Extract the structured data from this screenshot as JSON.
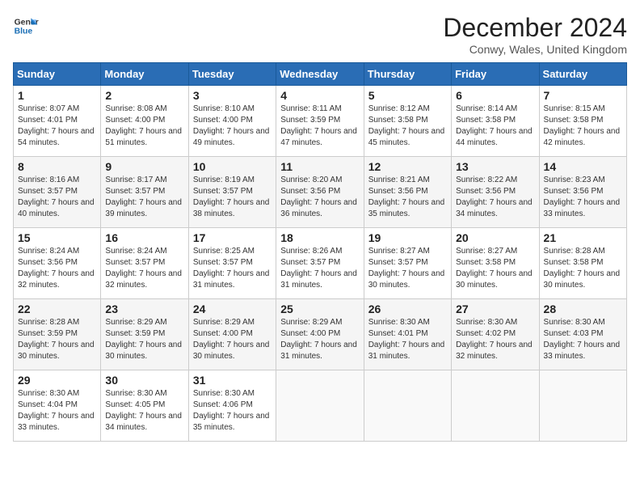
{
  "header": {
    "logo_line1": "General",
    "logo_line2": "Blue",
    "month": "December 2024",
    "location": "Conwy, Wales, United Kingdom"
  },
  "days_of_week": [
    "Sunday",
    "Monday",
    "Tuesday",
    "Wednesday",
    "Thursday",
    "Friday",
    "Saturday"
  ],
  "weeks": [
    [
      {
        "day": "1",
        "sunrise": "Sunrise: 8:07 AM",
        "sunset": "Sunset: 4:01 PM",
        "daylight": "Daylight: 7 hours and 54 minutes."
      },
      {
        "day": "2",
        "sunrise": "Sunrise: 8:08 AM",
        "sunset": "Sunset: 4:00 PM",
        "daylight": "Daylight: 7 hours and 51 minutes."
      },
      {
        "day": "3",
        "sunrise": "Sunrise: 8:10 AM",
        "sunset": "Sunset: 4:00 PM",
        "daylight": "Daylight: 7 hours and 49 minutes."
      },
      {
        "day": "4",
        "sunrise": "Sunrise: 8:11 AM",
        "sunset": "Sunset: 3:59 PM",
        "daylight": "Daylight: 7 hours and 47 minutes."
      },
      {
        "day": "5",
        "sunrise": "Sunrise: 8:12 AM",
        "sunset": "Sunset: 3:58 PM",
        "daylight": "Daylight: 7 hours and 45 minutes."
      },
      {
        "day": "6",
        "sunrise": "Sunrise: 8:14 AM",
        "sunset": "Sunset: 3:58 PM",
        "daylight": "Daylight: 7 hours and 44 minutes."
      },
      {
        "day": "7",
        "sunrise": "Sunrise: 8:15 AM",
        "sunset": "Sunset: 3:58 PM",
        "daylight": "Daylight: 7 hours and 42 minutes."
      }
    ],
    [
      {
        "day": "8",
        "sunrise": "Sunrise: 8:16 AM",
        "sunset": "Sunset: 3:57 PM",
        "daylight": "Daylight: 7 hours and 40 minutes."
      },
      {
        "day": "9",
        "sunrise": "Sunrise: 8:17 AM",
        "sunset": "Sunset: 3:57 PM",
        "daylight": "Daylight: 7 hours and 39 minutes."
      },
      {
        "day": "10",
        "sunrise": "Sunrise: 8:19 AM",
        "sunset": "Sunset: 3:57 PM",
        "daylight": "Daylight: 7 hours and 38 minutes."
      },
      {
        "day": "11",
        "sunrise": "Sunrise: 8:20 AM",
        "sunset": "Sunset: 3:56 PM",
        "daylight": "Daylight: 7 hours and 36 minutes."
      },
      {
        "day": "12",
        "sunrise": "Sunrise: 8:21 AM",
        "sunset": "Sunset: 3:56 PM",
        "daylight": "Daylight: 7 hours and 35 minutes."
      },
      {
        "day": "13",
        "sunrise": "Sunrise: 8:22 AM",
        "sunset": "Sunset: 3:56 PM",
        "daylight": "Daylight: 7 hours and 34 minutes."
      },
      {
        "day": "14",
        "sunrise": "Sunrise: 8:23 AM",
        "sunset": "Sunset: 3:56 PM",
        "daylight": "Daylight: 7 hours and 33 minutes."
      }
    ],
    [
      {
        "day": "15",
        "sunrise": "Sunrise: 8:24 AM",
        "sunset": "Sunset: 3:56 PM",
        "daylight": "Daylight: 7 hours and 32 minutes."
      },
      {
        "day": "16",
        "sunrise": "Sunrise: 8:24 AM",
        "sunset": "Sunset: 3:57 PM",
        "daylight": "Daylight: 7 hours and 32 minutes."
      },
      {
        "day": "17",
        "sunrise": "Sunrise: 8:25 AM",
        "sunset": "Sunset: 3:57 PM",
        "daylight": "Daylight: 7 hours and 31 minutes."
      },
      {
        "day": "18",
        "sunrise": "Sunrise: 8:26 AM",
        "sunset": "Sunset: 3:57 PM",
        "daylight": "Daylight: 7 hours and 31 minutes."
      },
      {
        "day": "19",
        "sunrise": "Sunrise: 8:27 AM",
        "sunset": "Sunset: 3:57 PM",
        "daylight": "Daylight: 7 hours and 30 minutes."
      },
      {
        "day": "20",
        "sunrise": "Sunrise: 8:27 AM",
        "sunset": "Sunset: 3:58 PM",
        "daylight": "Daylight: 7 hours and 30 minutes."
      },
      {
        "day": "21",
        "sunrise": "Sunrise: 8:28 AM",
        "sunset": "Sunset: 3:58 PM",
        "daylight": "Daylight: 7 hours and 30 minutes."
      }
    ],
    [
      {
        "day": "22",
        "sunrise": "Sunrise: 8:28 AM",
        "sunset": "Sunset: 3:59 PM",
        "daylight": "Daylight: 7 hours and 30 minutes."
      },
      {
        "day": "23",
        "sunrise": "Sunrise: 8:29 AM",
        "sunset": "Sunset: 3:59 PM",
        "daylight": "Daylight: 7 hours and 30 minutes."
      },
      {
        "day": "24",
        "sunrise": "Sunrise: 8:29 AM",
        "sunset": "Sunset: 4:00 PM",
        "daylight": "Daylight: 7 hours and 30 minutes."
      },
      {
        "day": "25",
        "sunrise": "Sunrise: 8:29 AM",
        "sunset": "Sunset: 4:00 PM",
        "daylight": "Daylight: 7 hours and 31 minutes."
      },
      {
        "day": "26",
        "sunrise": "Sunrise: 8:30 AM",
        "sunset": "Sunset: 4:01 PM",
        "daylight": "Daylight: 7 hours and 31 minutes."
      },
      {
        "day": "27",
        "sunrise": "Sunrise: 8:30 AM",
        "sunset": "Sunset: 4:02 PM",
        "daylight": "Daylight: 7 hours and 32 minutes."
      },
      {
        "day": "28",
        "sunrise": "Sunrise: 8:30 AM",
        "sunset": "Sunset: 4:03 PM",
        "daylight": "Daylight: 7 hours and 33 minutes."
      }
    ],
    [
      {
        "day": "29",
        "sunrise": "Sunrise: 8:30 AM",
        "sunset": "Sunset: 4:04 PM",
        "daylight": "Daylight: 7 hours and 33 minutes."
      },
      {
        "day": "30",
        "sunrise": "Sunrise: 8:30 AM",
        "sunset": "Sunset: 4:05 PM",
        "daylight": "Daylight: 7 hours and 34 minutes."
      },
      {
        "day": "31",
        "sunrise": "Sunrise: 8:30 AM",
        "sunset": "Sunset: 4:06 PM",
        "daylight": "Daylight: 7 hours and 35 minutes."
      },
      null,
      null,
      null,
      null
    ]
  ]
}
